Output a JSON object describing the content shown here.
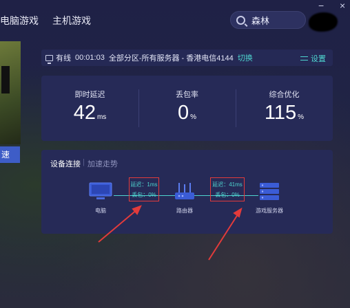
{
  "nav": {
    "tabs": [
      {
        "label": "电脑游戏"
      },
      {
        "label": "主机游戏"
      }
    ]
  },
  "search": {
    "value": "森林",
    "icon": "search-icon"
  },
  "window": {
    "close_symbol": "×",
    "minimize_symbol": "−"
  },
  "side_art": {
    "button_label": "速"
  },
  "status": {
    "connection": "有线",
    "elapsed": "00:01:03",
    "server": "全部分区-所有服务器 - 香港电信4144",
    "switch_label": "切换",
    "settings_label": "设置"
  },
  "stats": [
    {
      "label": "即时延迟",
      "value": "42",
      "unit": "ms"
    },
    {
      "label": "丢包率",
      "value": "0",
      "unit": "%"
    },
    {
      "label": "综合优化",
      "value": "115",
      "unit": "%"
    }
  ],
  "devices": {
    "tabs": [
      {
        "label": "设备连接"
      },
      {
        "label": "加速走势"
      }
    ],
    "items": [
      {
        "label": "电脑",
        "icon": "monitor-icon"
      },
      {
        "label": "路由器",
        "icon": "router-icon"
      },
      {
        "label": "游戏服务器",
        "icon": "server-icon"
      }
    ],
    "links": [
      {
        "latency": "延迟：1ms",
        "loss": "丢包：0%"
      },
      {
        "latency": "延迟：41ms",
        "loss": "丢包：0%"
      }
    ]
  },
  "colors": {
    "accent": "#4fd6d0",
    "annotation": "#e33b3b",
    "panel": "#262a57",
    "background": "#1b1c3c"
  }
}
